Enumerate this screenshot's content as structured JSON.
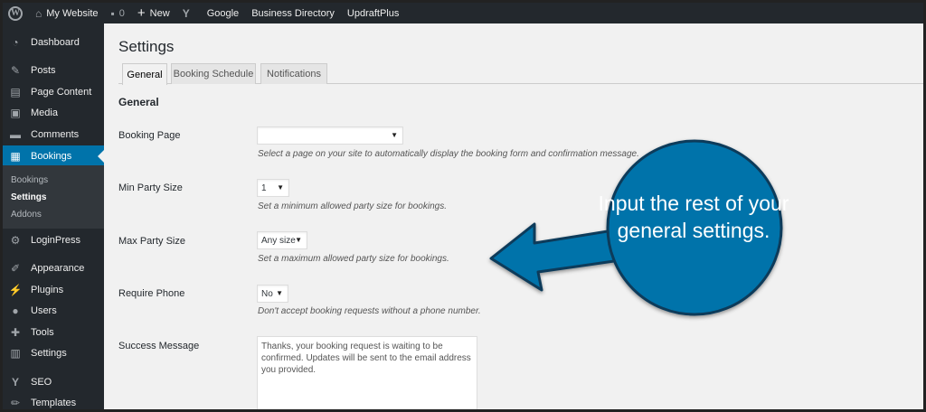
{
  "adminbar": {
    "site_name": "My Website",
    "comments_count": "0",
    "new_label": "New",
    "links": [
      "Google",
      "Business Directory",
      "UpdraftPlus"
    ]
  },
  "sidebar": {
    "items": [
      {
        "label": "Dashboard",
        "icon": "dashboard-icon"
      },
      {
        "label": "Posts",
        "icon": "pin-icon"
      },
      {
        "label": "Page Content",
        "icon": "pages-icon"
      },
      {
        "label": "Media",
        "icon": "media-icon"
      },
      {
        "label": "Comments",
        "icon": "comment-icon"
      },
      {
        "label": "Bookings",
        "icon": "calendar-icon",
        "active": true
      },
      {
        "label": "LoginPress",
        "icon": "gear-icon"
      },
      {
        "label": "Appearance",
        "icon": "brush-icon"
      },
      {
        "label": "Plugins",
        "icon": "plug-icon"
      },
      {
        "label": "Users",
        "icon": "user-icon"
      },
      {
        "label": "Tools",
        "icon": "wrench-icon"
      },
      {
        "label": "Settings",
        "icon": "settings-icon"
      },
      {
        "label": "SEO",
        "icon": "seo-icon"
      },
      {
        "label": "Templates",
        "icon": "pencil-icon"
      }
    ],
    "submenu": [
      {
        "label": "Bookings"
      },
      {
        "label": "Settings",
        "current": true
      },
      {
        "label": "Addons"
      }
    ]
  },
  "main": {
    "title": "Settings",
    "tabs": [
      {
        "label": "General",
        "active": true
      },
      {
        "label": "Booking Schedule"
      },
      {
        "label": "Notifications"
      }
    ],
    "section_title": "General",
    "fields": {
      "booking_page": {
        "label": "Booking Page",
        "value": "",
        "description": "Select a page on your site to automatically display the booking form and confirmation message."
      },
      "min_party": {
        "label": "Min Party Size",
        "value": "1",
        "description": "Set a minimum allowed party size for bookings."
      },
      "max_party": {
        "label": "Max Party Size",
        "value": "Any size",
        "description": "Set a maximum allowed party size for bookings."
      },
      "require_phone": {
        "label": "Require Phone",
        "value": "No",
        "description": "Don't accept booking requests without a phone number."
      },
      "success_message": {
        "label": "Success Message",
        "value": "Thanks, your booking request is waiting to be confirmed. Updates will be sent to the email address you provided."
      }
    }
  },
  "annotation": {
    "text": "Input the rest of your general settings.",
    "color": "#0073aa"
  },
  "colors": {
    "admin_dark": "#23282d",
    "accent": "#0073aa"
  }
}
